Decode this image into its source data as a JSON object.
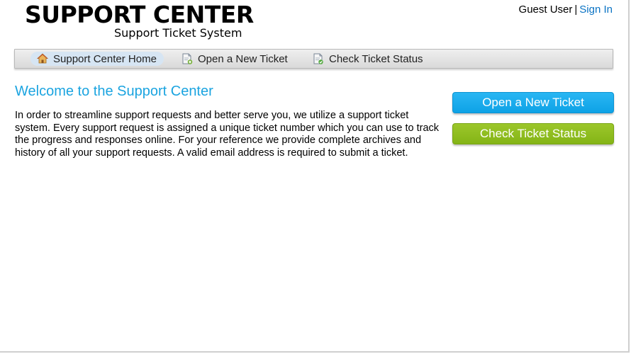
{
  "header": {
    "title": "SUPPORT CENTER",
    "subtitle": "Support Ticket System",
    "user_label": "Guest User",
    "separator": "|",
    "signin_label": "Sign In"
  },
  "nav": {
    "items": [
      {
        "label": "Support Center Home",
        "icon": "home-icon",
        "active": true
      },
      {
        "label": "Open a New Ticket",
        "icon": "new-ticket-icon",
        "active": false
      },
      {
        "label": "Check Ticket Status",
        "icon": "ticket-status-icon",
        "active": false
      }
    ]
  },
  "main": {
    "heading": "Welcome to the Support Center",
    "intro": "In order to streamline support requests and better serve you, we utilize a support ticket system. Every support request is assigned a unique ticket number which you can use to track the progress and responses online. For your reference we provide complete archives and history of all your support requests. A valid email address is required to submit a ticket."
  },
  "sidebar": {
    "open_ticket_label": "Open a New Ticket",
    "check_status_label": "Check Ticket Status"
  },
  "colors": {
    "accent_blue": "#1ba4e0",
    "link_blue": "#0a73c4",
    "button_blue": "#13a7ea",
    "button_green": "#8fbd1f",
    "nav_active_bg": "#d6e5f3"
  }
}
